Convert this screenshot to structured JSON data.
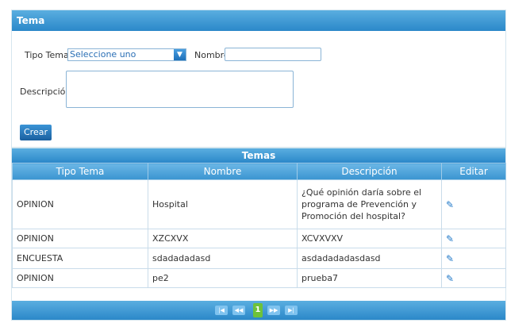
{
  "form": {
    "title": "Tema",
    "tipo_label": "Tipo Tema",
    "tipo_value": "Seleccione uno",
    "nombre_label": "Nombre",
    "nombre_value": "",
    "descripcion_label": "Descripción",
    "descripcion_value": "",
    "create_label": "Crear"
  },
  "grid": {
    "title": "Temas",
    "columns": [
      "Tipo Tema",
      "Nombre",
      "Descripción",
      "Editar"
    ],
    "rows": [
      {
        "tipo": "OPINION",
        "nombre": "Hospital",
        "descripcion": "¿Qué opinión daría sobre el programa de Prevención y Promoción del hospital?"
      },
      {
        "tipo": "OPINION",
        "nombre": "XZCXVX",
        "descripcion": "XCVXVXV"
      },
      {
        "tipo": "ENCUESTA",
        "nombre": "sdadadadasd",
        "descripcion": "asdadadadasdasd"
      },
      {
        "tipo": "OPINION",
        "nombre": "pe2",
        "descripcion": "prueba7"
      }
    ],
    "pager": {
      "first": "|◀",
      "prev": "◀◀",
      "current": "1",
      "next": "▶▶",
      "last": "▶|"
    }
  },
  "icons": {
    "dropdown": "chevron-down-icon",
    "edit": "pencil-icon"
  }
}
